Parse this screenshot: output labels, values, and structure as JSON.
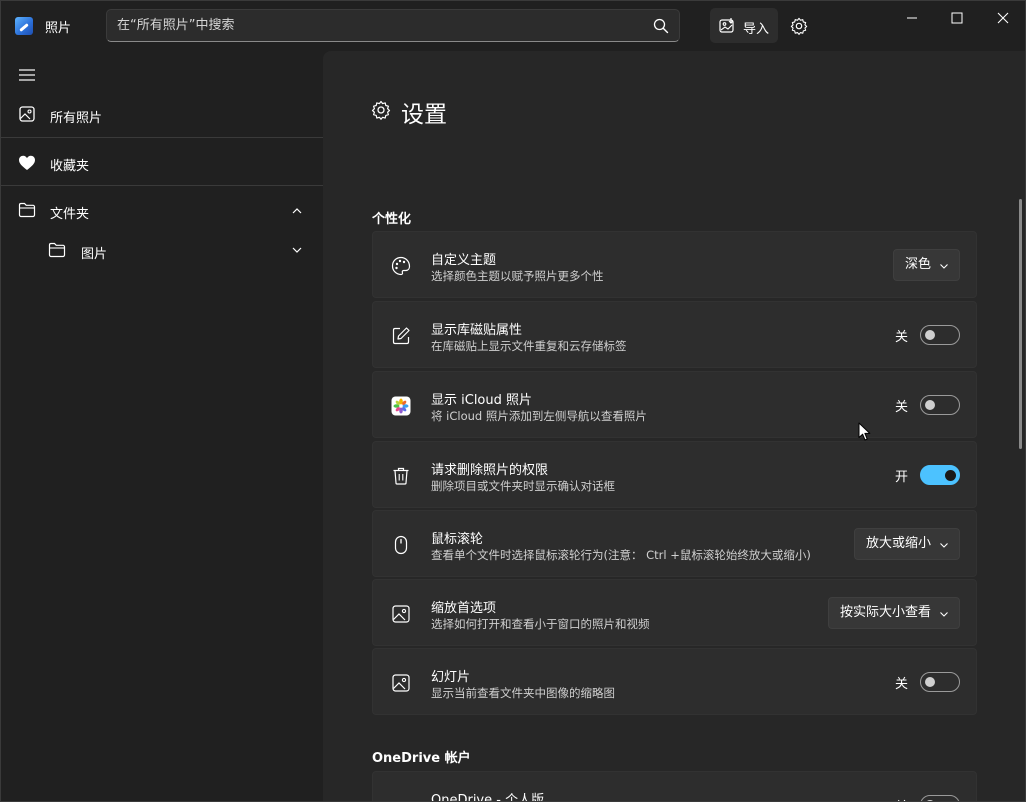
{
  "app": {
    "title": "照片"
  },
  "search": {
    "placeholder": "在“所有照片”中搜索"
  },
  "toolbar": {
    "import_label": "导入"
  },
  "sidebar": {
    "items": [
      {
        "label": "所有照片",
        "icon": "photo-icon"
      },
      {
        "label": "收藏夹",
        "icon": "heart-icon"
      },
      {
        "label": "文件夹",
        "icon": "folder-icon"
      },
      {
        "label": "图片",
        "icon": "folder-icon"
      }
    ]
  },
  "settings": {
    "title": "设置",
    "sections": [
      {
        "heading": "个性化"
      },
      {
        "heading": "OneDrive 帐户"
      }
    ],
    "cards": [
      {
        "title": "自定义主题",
        "desc": "选择颜色主题以赋予照片更多个性",
        "control": "dropdown",
        "value": "深色",
        "icon": "palette-icon"
      },
      {
        "title": "显示库磁贴属性",
        "desc": "在库磁贴上显示文件重复和云存储标签",
        "control": "toggle",
        "state": "关",
        "on": false,
        "icon": "edit-icon"
      },
      {
        "title": "显示 iCloud 照片",
        "desc": "将 iCloud 照片添加到左侧导航以查看照片",
        "control": "toggle",
        "state": "关",
        "on": false,
        "icon": "icloud-photos-icon"
      },
      {
        "title": "请求删除照片的权限",
        "desc": "删除项目或文件夹时显示确认对话框",
        "control": "toggle",
        "state": "开",
        "on": true,
        "icon": "trash-icon"
      },
      {
        "title": "鼠标滚轮",
        "desc": "查看单个文件时选择鼠标滚轮行为(注意： Ctrl +鼠标滚轮始终放大或缩小)",
        "control": "dropdown",
        "value": "放大或缩小",
        "icon": "mouse-icon"
      },
      {
        "title": "缩放首选项",
        "desc": "选择如何打开和查看小于窗口的照片和视频",
        "control": "dropdown",
        "value": "按实际大小查看",
        "icon": "image-icon"
      },
      {
        "title": "幻灯片",
        "desc": "显示当前查看文件夹中图像的缩略图",
        "control": "toggle",
        "state": "关",
        "on": false,
        "icon": "image-icon"
      },
      {
        "title": "OneDrive - 个人版",
        "desc": "",
        "control": "toggle",
        "state": "关",
        "on": false,
        "icon": "onedrive-icon"
      }
    ]
  },
  "colors": {
    "accent": "#4cc2ff",
    "background": "#202020",
    "content_bg": "#272727",
    "card_bg": "#2d2d2d"
  }
}
